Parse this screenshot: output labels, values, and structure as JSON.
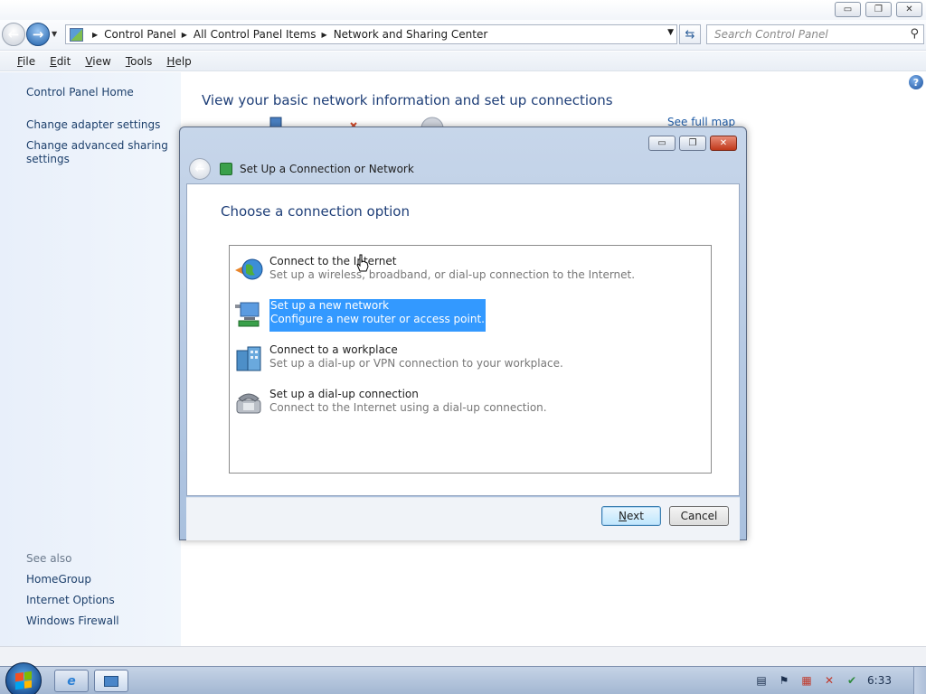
{
  "window": {
    "minimize_glyph": "▭",
    "restore_glyph": "❐",
    "close_glyph": "✕"
  },
  "address_bar": {
    "breadcrumbs": [
      "Control Panel",
      "All Control Panel Items",
      "Network and Sharing Center"
    ],
    "search_placeholder": "Search Control Panel"
  },
  "menu": {
    "items": [
      "File",
      "Edit",
      "View",
      "Tools",
      "Help"
    ]
  },
  "sidebar": {
    "home": "Control Panel Home",
    "links": [
      "Change adapter settings",
      "Change advanced sharing settings"
    ],
    "see_also_heading": "See also",
    "see_also": [
      "HomeGroup",
      "Internet Options",
      "Windows Firewall"
    ]
  },
  "main": {
    "heading": "View your basic network information and set up connections",
    "see_full_map": "See full map",
    "help_glyph": "?"
  },
  "dialog": {
    "title": "Set Up a Connection or Network",
    "heading": "Choose a connection option",
    "options": [
      {
        "title": "Connect to the Internet",
        "desc": "Set up a wireless, broadband, or dial-up connection to the Internet.",
        "icon": "globe-icon",
        "selected": false
      },
      {
        "title": "Set up a new network",
        "desc": "Configure a new router or access point.",
        "icon": "network-computer-icon",
        "selected": true
      },
      {
        "title": "Connect to a workplace",
        "desc": "Set up a dial-up or VPN connection to your workplace.",
        "icon": "workplace-icon",
        "selected": false
      },
      {
        "title": "Set up a dial-up connection",
        "desc": "Connect to the Internet using a dial-up connection.",
        "icon": "phone-icon",
        "selected": false
      }
    ],
    "next_label": "Next",
    "cancel_label": "Cancel"
  },
  "taskbar": {
    "clock": "6:33",
    "tray_icons": [
      "notepad-icon",
      "flag-icon",
      "network-icon",
      "volume-muted-icon",
      "security-icon"
    ]
  },
  "colors": {
    "accent": "#3399ff",
    "heading": "#1f3f78",
    "link": "#1c3f6b"
  }
}
